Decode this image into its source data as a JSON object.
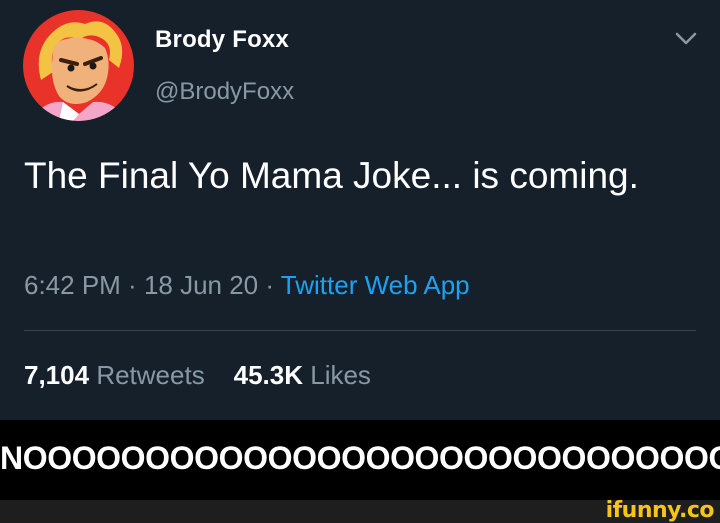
{
  "tweet": {
    "display_name": "Brody Foxx",
    "handle": "@BrodyFoxx",
    "avatar_icon": "cartoon-avatar-icon",
    "menu_icon": "chevron-down-icon",
    "text": "The Final Yo Mama Joke... is coming.",
    "time": "6:42 PM",
    "sep1": " · ",
    "date": "18 Jun 20",
    "sep2": " · ",
    "source": "Twitter Web App",
    "retweets_count": "7,104",
    "retweets_label": "Retweets",
    "likes_count": "45.3K",
    "likes_label": "Likes"
  },
  "caption": {
    "text": "NOOOOOOOOOOOOOOOOOOOOOOOOOOOOO!"
  },
  "watermark": {
    "text": "ifunny.co"
  },
  "colors": {
    "background": "#15202b",
    "text": "#ffffff",
    "muted": "#8899a6",
    "link": "#1da1f2",
    "caption_bg": "#000000",
    "watermark": "#f5c518"
  }
}
